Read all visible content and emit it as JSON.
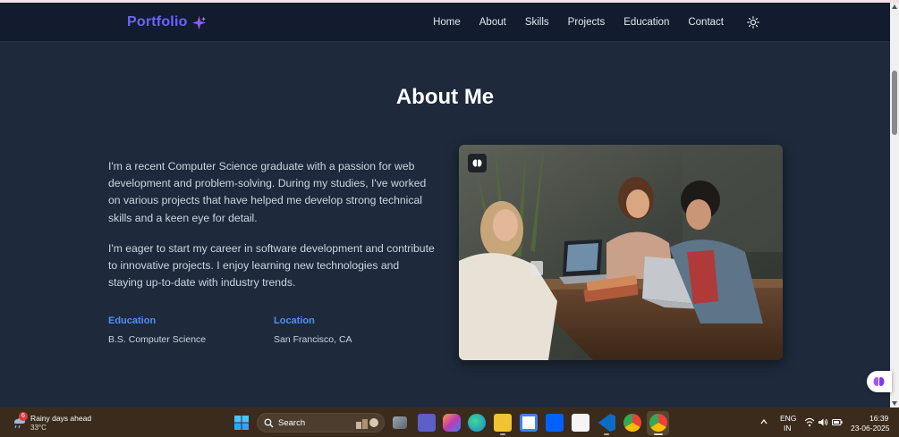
{
  "navbar": {
    "logo": "Portfolio",
    "links": [
      "Home",
      "About",
      "Skills",
      "Projects",
      "Education",
      "Contact"
    ]
  },
  "about": {
    "title": "About Me",
    "paragraphs": [
      "I'm a recent Computer Science graduate with a passion for web development and problem-solving. During my studies, I've worked on various projects that have helped me develop strong technical skills and a keen eye for detail.",
      "I'm eager to start my career in software development and contribute to innovative projects. I enjoy learning new technologies and staying up-to-date with industry trends."
    ],
    "info": [
      {
        "label": "Education",
        "value": "B.S. Computer Science"
      },
      {
        "label": "Location",
        "value": "San Francisco, CA"
      }
    ]
  },
  "taskbar": {
    "weather": {
      "badge": "6",
      "title": "Rainy days ahead",
      "temp": "33°C"
    },
    "search_placeholder": "Search",
    "tray": {
      "lang_line1": "ENG",
      "lang_line2": "IN",
      "time": "16:39",
      "date": "23-06-2025"
    }
  },
  "colors": {
    "page_bg": "#1e293b",
    "navbar_bg": "#131b2e",
    "logo": "#6c63ff",
    "info_label": "#4f8ff7",
    "taskbar_bg": "#3a2b1c"
  },
  "icons": [
    "sparkle-icon",
    "sun-icon",
    "windows-logo-icon",
    "search-icon",
    "weather-icon",
    "wifi-icon",
    "volume-icon",
    "battery-icon"
  ]
}
